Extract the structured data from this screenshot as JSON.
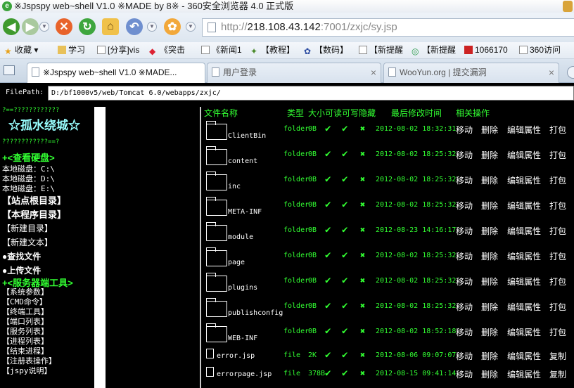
{
  "window": {
    "title": "※Jspspy web~shell V1.0 ※MADE by 8※ - 360安全浏览器 4.0 正式版"
  },
  "address": {
    "scheme": "http://",
    "host": "218.108.43.142",
    "rest": ":7001/zxjc/sy.jsp"
  },
  "bookmarks": [
    {
      "label": "收藏",
      "icon": "star-icon"
    },
    {
      "label": "学习",
      "icon": "folder-icon"
    },
    {
      "label": "[分享]vis",
      "icon": "page-icon"
    },
    {
      "label": "《突击",
      "icon": "flame-icon"
    },
    {
      "label": "《新闻1",
      "icon": "page-icon"
    },
    {
      "label": "【教程】",
      "icon": "frog-icon"
    },
    {
      "label": "【数码】",
      "icon": "paw-icon"
    },
    {
      "label": "【新提醒",
      "icon": "page-icon"
    },
    {
      "label": "【新提醒",
      "icon": "globe-icon"
    },
    {
      "label": "1066170",
      "icon": "flag-icon"
    },
    {
      "label": "360访问",
      "icon": "page-icon"
    }
  ],
  "tabs": [
    {
      "label": "※Jspspy web~shell V1.0 ※MADE...",
      "active": true
    },
    {
      "label": "用户登录",
      "active": false
    },
    {
      "label": "WooYun.org | 提交漏洞",
      "active": false
    }
  ],
  "filepath": {
    "label": "FilePath:",
    "value": "D:/bf1000v5/web/Tomcat 6.0/webapps/zxjc/"
  },
  "leftmenu": {
    "top_marks": "?==????????????",
    "brand": "☆孤水绕城☆",
    "sub_marks": "????????????==?",
    "disk_header": "+<查看硬盘>",
    "disks": [
      "本地磁盘：C:\\",
      "本地磁盘：D:\\",
      "本地磁盘：E:\\"
    ],
    "site_root": "【站点根目录】",
    "program_dir": "【本程序目录】",
    "new_dir": "【新建目录】",
    "new_file": "【新建文本】",
    "find_file": "●查找文件",
    "upload_file": "●上传文件",
    "server_tools_header": "+<服务器端工具>",
    "tools": [
      "【系统参数】",
      "【CMD命令】",
      "【终端工具】",
      "【端口列表】",
      "【服务列表】",
      "【进程列表】",
      "【结束进程】",
      "【注册表操作】",
      "【jspy说明】"
    ]
  },
  "filelist": {
    "headers": {
      "name": "文件名称",
      "type": "类型",
      "size": "大小",
      "read": "可读",
      "write": "可写",
      "hidden": "隐藏",
      "modified": "最后修改时间",
      "actions": "相关操作"
    },
    "rows": [
      {
        "kind": "folder",
        "name": "ClientBin",
        "type": "folder",
        "size": "0B",
        "date": "2012-08-02 18:32:31",
        "a1": "移动",
        "a2": "删除",
        "a3": "编辑属性",
        "a4": "打包"
      },
      {
        "kind": "folder",
        "name": "content",
        "type": "folder",
        "size": "0B",
        "date": "2012-08-02 18:25:32",
        "a1": "移动",
        "a2": "删除",
        "a3": "编辑属性",
        "a4": "打包"
      },
      {
        "kind": "folder",
        "name": "inc",
        "type": "folder",
        "size": "0B",
        "date": "2012-08-02 18:25:32",
        "a1": "移动",
        "a2": "删除",
        "a3": "编辑属性",
        "a4": "打包"
      },
      {
        "kind": "folder",
        "name": "META-INF",
        "type": "folder",
        "size": "0B",
        "date": "2012-08-02 18:25:32",
        "a1": "移动",
        "a2": "删除",
        "a3": "编辑属性",
        "a4": "打包"
      },
      {
        "kind": "folder",
        "name": "module",
        "type": "folder",
        "size": "0B",
        "date": "2012-08-23 14:16:17",
        "a1": "移动",
        "a2": "删除",
        "a3": "编辑属性",
        "a4": "打包"
      },
      {
        "kind": "folder",
        "name": "page",
        "type": "folder",
        "size": "0B",
        "date": "2012-08-02 18:25:32",
        "a1": "移动",
        "a2": "删除",
        "a3": "编辑属性",
        "a4": "打包"
      },
      {
        "kind": "folder",
        "name": "plugins",
        "type": "folder",
        "size": "0B",
        "date": "2012-08-02 18:25:32",
        "a1": "移动",
        "a2": "删除",
        "a3": "编辑属性",
        "a4": "打包"
      },
      {
        "kind": "folder",
        "name": "publishconfig",
        "type": "folder",
        "size": "0B",
        "date": "2012-08-02 18:25:32",
        "a1": "移动",
        "a2": "删除",
        "a3": "编辑属性",
        "a4": "打包"
      },
      {
        "kind": "folder",
        "name": "WEB-INF",
        "type": "folder",
        "size": "0B",
        "date": "2012-08-02 18:52:18",
        "a1": "移动",
        "a2": "删除",
        "a3": "编辑属性",
        "a4": "打包"
      },
      {
        "kind": "file",
        "name": "error.jsp",
        "type": "file",
        "size": "2K",
        "date": "2012-08-06 09:07:07",
        "a1": "移动",
        "a2": "删除",
        "a3": "编辑属性",
        "a4": "复制"
      },
      {
        "kind": "file",
        "name": "errorpage.jsp",
        "type": "file",
        "size": "378B",
        "date": "2012-08-15 09:41:14",
        "a1": "移动",
        "a2": "删除",
        "a3": "编辑属性",
        "a4": "复制"
      }
    ]
  },
  "colors": {
    "accent_green": "#32ff32",
    "background": "#000000"
  }
}
